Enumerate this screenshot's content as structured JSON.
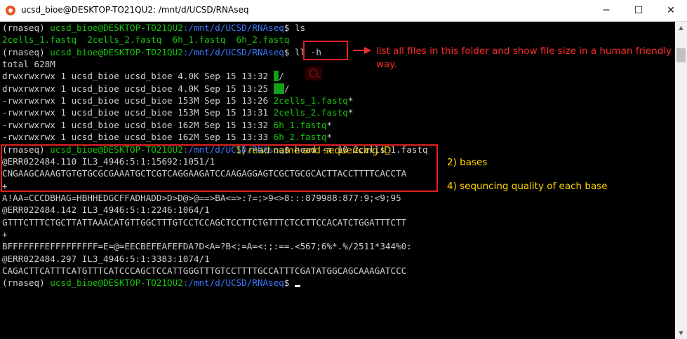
{
  "window": {
    "title": "ucsd_bioe@DESKTOP-TO21QU2: /mnt/d/UCSD/RNAseq",
    "minimize": "─",
    "maximize": "☐",
    "close": "✕"
  },
  "prompt": {
    "env": "(rnaseq) ",
    "userhost": "ucsd_bioe@DESKTOP-TO21QU2",
    "path": ":/mnt/d/UCSD/RNAseq",
    "symbol": "$ "
  },
  "commands": {
    "ls": "ls",
    "ll": "ll -h",
    "head": "head -n 10 2cells_1.fastq"
  },
  "ls_output": "2cells_1.fastq  2cells_2.fastq  6h_1.fastq  6h_2.fastq",
  "total": "total 628M",
  "listing": [
    {
      "info": "drwxrwxrwx 1 ucsd_bioe ucsd_bioe 4.0K Sep 15 13:32 ",
      "name": ".",
      "suffix": "/"
    },
    {
      "info": "drwxrwxrwx 1 ucsd_bioe ucsd_bioe 4.0K Sep 15 13:25 ",
      "name": "..",
      "suffix": "/"
    },
    {
      "info": "-rwxrwxrwx 1 ucsd_bioe ucsd_bioe 153M Sep 15 13:26 ",
      "name": "2cells_1.fastq",
      "suffix": "*"
    },
    {
      "info": "-rwxrwxrwx 1 ucsd_bioe ucsd_bioe 153M Sep 15 13:31 ",
      "name": "2cells_2.fastq",
      "suffix": "*"
    },
    {
      "info": "-rwxrwxrwx 1 ucsd_bioe ucsd_bioe 162M Sep 15 13:32 ",
      "name": "6h_1.fastq",
      "suffix": "*"
    },
    {
      "info": "-rwxrwxrwx 1 ucsd_bioe ucsd_bioe 162M Sep 15 13:33 ",
      "name": "6h_2.fastq",
      "suffix": "*"
    }
  ],
  "fastq": [
    "@ERR022484.110 IL3_4946:5:1:15692:1051/1",
    "CNGAAGCAAAGTGTGTGCGCGAAATGCTCGTCAGGAAGATCCAAGAGGAGTCGCTGCGCACTTACCTTTTCACCTA",
    "+",
    "A!AA=CCCDBHAG=HBHHEDGCFFADHADD>D>D@>@==>BA<=>:?=;>9<>8:::879988:877:9;<9;95",
    "@ERR022484.142 IL3_4946:5:1:2246:1064/1",
    "GTTTCTTTCTGCTTATTAAACATGTTGGCTTTGTCCTCCAGCTCCTTCTGTTTCTCCTTCCACATCTGGATTTCTT",
    "+",
    "BFFFFFFFEFFFFFFFFF=E=@=EECBEFEAFEFDA?D<A=?B<;=A=<:;:==.<567;6%*.%/2511*344%0:",
    "@ERR022484.297 IL3_4946:5:1:3383:1074/1",
    "CAGACTTCATTTCATGTTTCATCCCAGCTCCATTGGGTTTGTCCTTTTGCCATTTCGATATGGCAGCAAAGATCCC"
  ],
  "annotations": {
    "ll_note": "list all files in this folder and show file size in a human friendly way.",
    "read_name": "1) read name and sequencing ID",
    "bases": "2) bases",
    "quality": "4) sequncing quality of each base"
  },
  "colors": {
    "green": "#16c60c",
    "blue": "#3b78ff",
    "annotation_red": "#ff2a2a",
    "annotation_yellow": "#ffd700"
  }
}
